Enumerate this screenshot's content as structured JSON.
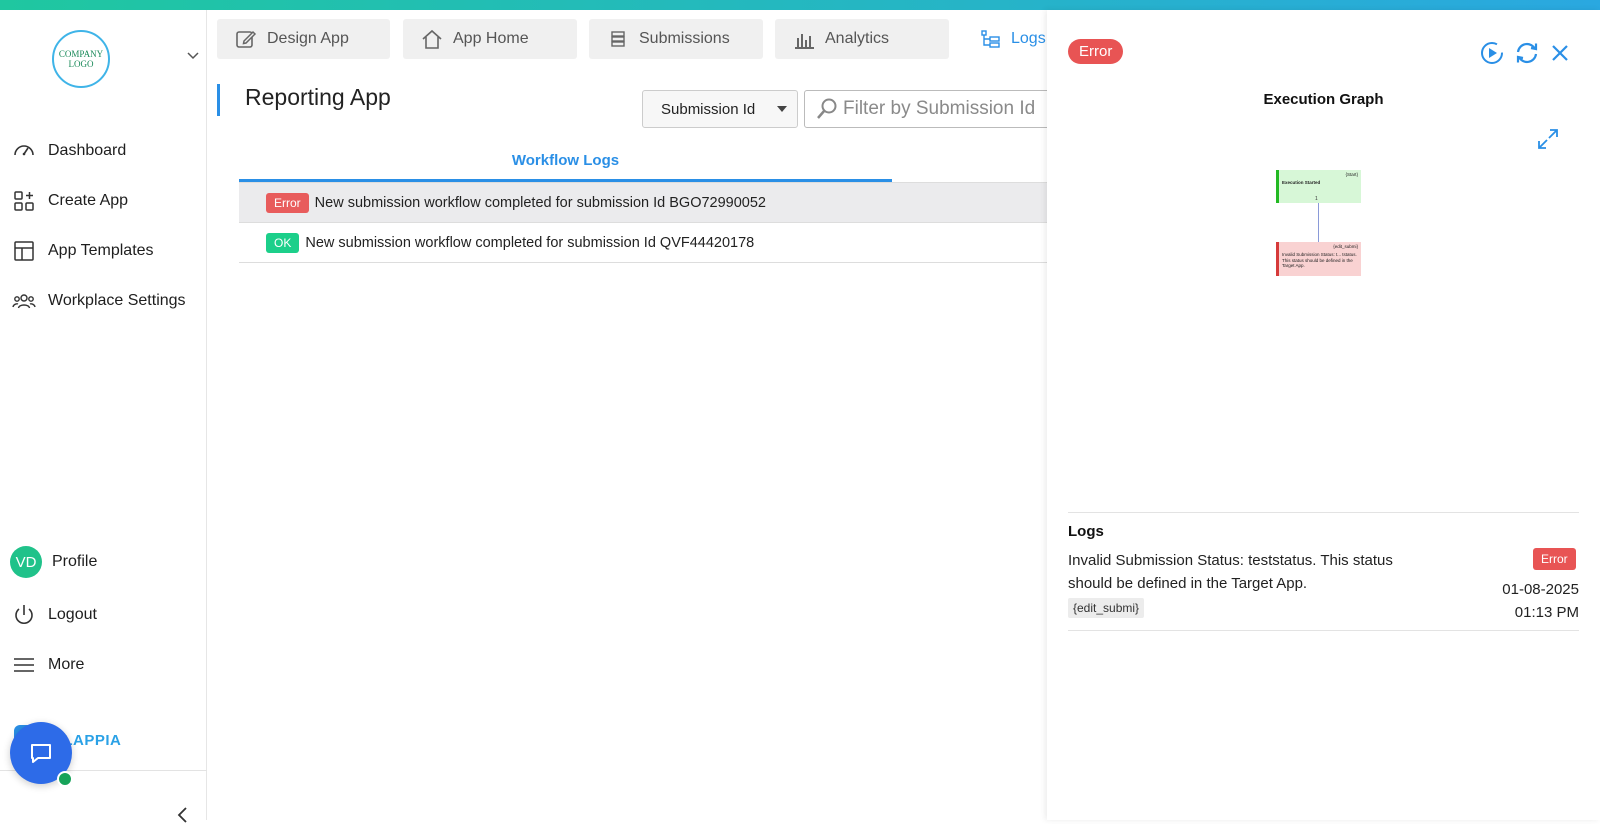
{
  "brand": {
    "logo_text": "COMPANY LOGO",
    "name": "CLAPPIA"
  },
  "sidebar": {
    "items": [
      {
        "label": "Dashboard"
      },
      {
        "label": "Create App"
      },
      {
        "label": "App Templates"
      },
      {
        "label": "Workplace Settings"
      }
    ],
    "profile": {
      "initials": "VD",
      "label": "Profile"
    },
    "logout_label": "Logout",
    "more_label": "More"
  },
  "tabs": [
    {
      "label": "Design App"
    },
    {
      "label": "App Home"
    },
    {
      "label": "Submissions"
    },
    {
      "label": "Analytics"
    },
    {
      "label": "Logs"
    }
  ],
  "page": {
    "title": "Reporting App"
  },
  "filter": {
    "selected": "Submission Id",
    "search_placeholder": "Filter by Submission Id"
  },
  "workflow": {
    "tab_label": "Workflow Logs",
    "rows": [
      {
        "status": "Error",
        "text": "New submission workflow completed for submission Id BGO72990052"
      },
      {
        "status": "OK",
        "text": "New submission workflow completed for submission Id QVF44420178"
      }
    ]
  },
  "panel": {
    "status": "Error",
    "graph_title": "Execution Graph",
    "nodes": [
      {
        "tag": "{Start}",
        "title": "Execution Started"
      },
      {
        "tag": "{edit_submi}",
        "title": "Invalid Submission Status: t... tstatus. This status should be defined in the Target App."
      }
    ],
    "edge_label": "1",
    "logs_title": "Logs",
    "log": {
      "message": "Invalid Submission Status: teststatus. This status should be defined in the Target App.",
      "chip": "{edit_submi}",
      "status": "Error",
      "date": "01-08-2025",
      "time": "01:13 PM"
    }
  },
  "colors": {
    "accent": "#2a8fe6",
    "error": "#e85454",
    "ok": "#1ccf8a"
  }
}
